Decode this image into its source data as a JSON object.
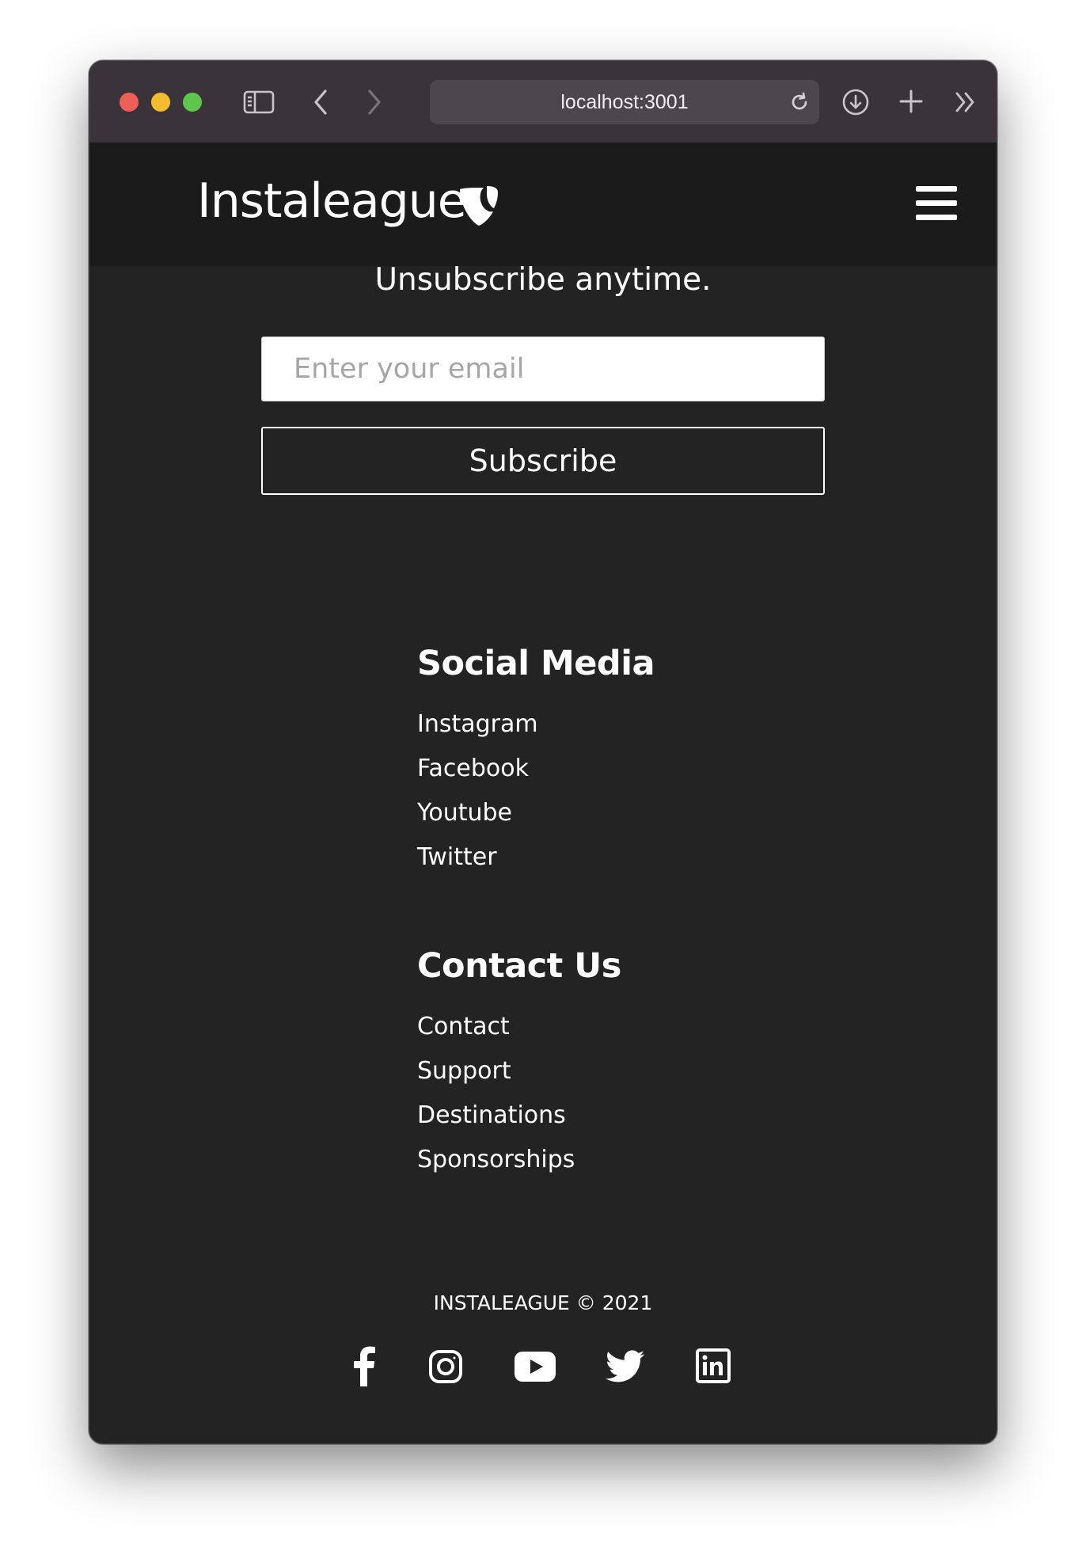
{
  "browser": {
    "url": "localhost:3001",
    "icons": [
      "sidebar-icon",
      "back-icon",
      "forward-icon",
      "reload-icon",
      "download-icon",
      "new-tab-icon",
      "more-icon"
    ]
  },
  "header": {
    "logo_text": "Instaleague",
    "logo_icon": "typo3-shield-icon",
    "menu_icon": "hamburger-menu-icon"
  },
  "newsletter": {
    "tagline": "Unsubscribe anytime.",
    "email_placeholder": "Enter your email",
    "email_value": "",
    "subscribe_label": "Subscribe"
  },
  "footer": {
    "social": {
      "heading": "Social Media",
      "links": [
        "Instagram",
        "Facebook",
        "Youtube",
        "Twitter"
      ]
    },
    "contact": {
      "heading": "Contact Us",
      "links": [
        "Contact",
        "Support",
        "Destinations",
        "Sponsorships"
      ]
    },
    "copyright": "INSTALEAGUE © 2021",
    "social_icons": [
      "facebook-icon",
      "instagram-icon",
      "youtube-icon",
      "twitter-icon",
      "linkedin-icon"
    ]
  },
  "colors": {
    "page_bg": "#232324",
    "header_bg": "#1b1b1b",
    "titlebar_bg": "#3a3339",
    "text": "#ffffff"
  }
}
